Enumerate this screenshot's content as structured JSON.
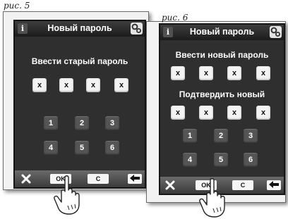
{
  "fig5": {
    "label": "рис. 5",
    "header": {
      "info": "i",
      "title": "Новый пароль",
      "settings_icon": "gear-icon"
    },
    "heading": "Ввести старый пароль",
    "code_cells": [
      "x",
      "x",
      "x",
      "x"
    ],
    "keypad": [
      "1",
      "2",
      "3",
      "4",
      "5",
      "6"
    ],
    "bottom_bar": {
      "cancel_icon": "x-icon",
      "ok": "OK",
      "clear": "C",
      "back_icon": "arrow-left-icon"
    }
  },
  "fig6": {
    "label": "рис. 6",
    "header": {
      "info": "i",
      "title": "Новый пароль",
      "settings_icon": "gear-icon"
    },
    "heading_new": "Ввести новый пароль",
    "new_cells": [
      "x",
      "x",
      "x",
      "x"
    ],
    "heading_confirm": "Подтвердить новый",
    "confirm_cells": [
      "x",
      "x",
      "x",
      "x"
    ],
    "keypad": [
      "1",
      "2",
      "3",
      "4",
      "5",
      "6"
    ],
    "bottom_bar": {
      "cancel_icon": "x-icon",
      "ok": "OK",
      "clear": "C",
      "back_icon": "arrow-left-icon"
    }
  }
}
